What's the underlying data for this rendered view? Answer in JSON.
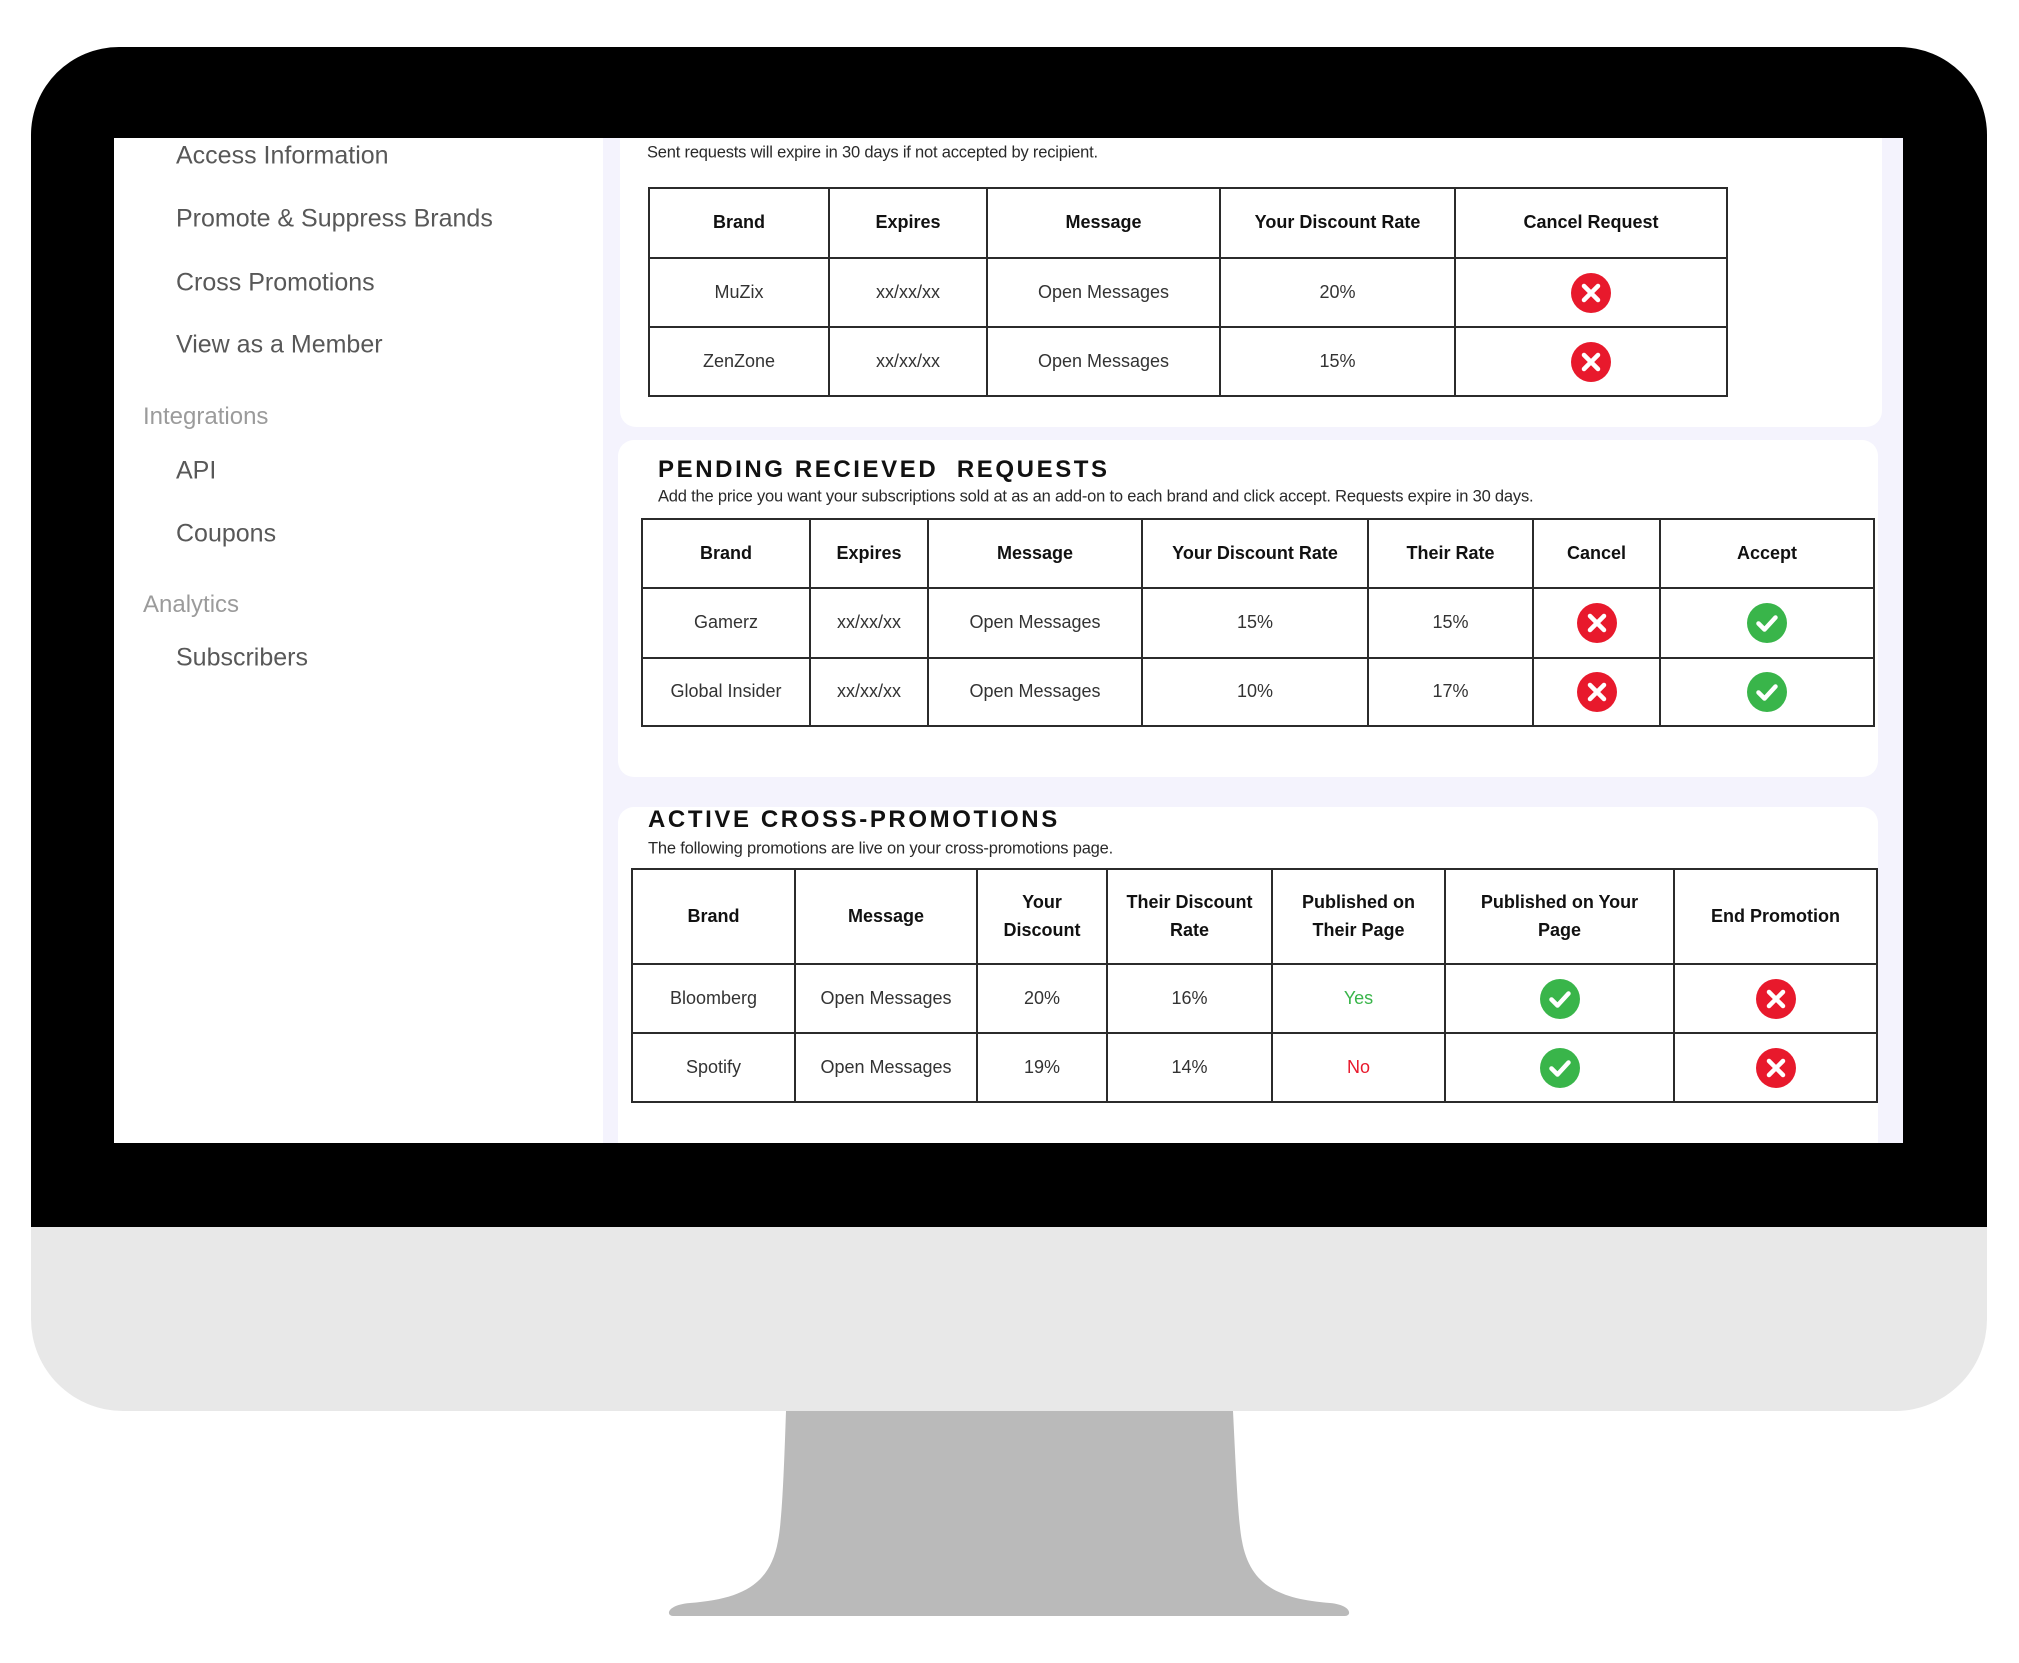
{
  "sidebar": {
    "items_top": [
      {
        "label": "Access Information"
      },
      {
        "label": "Promote & Suppress Brands"
      },
      {
        "label": "Cross Promotions"
      },
      {
        "label": "View as a Member"
      }
    ],
    "sections": [
      {
        "label": "Integrations",
        "items": [
          {
            "label": "API"
          },
          {
            "label": "Coupons"
          }
        ]
      },
      {
        "label": "Analytics",
        "items": [
          {
            "label": "Subscribers"
          }
        ]
      }
    ]
  },
  "sent_requests": {
    "subtitle": "Sent requests will expire in 30 days if not accepted by recipient.",
    "columns": [
      "Brand",
      "Expires",
      "Message",
      "Your Discount Rate",
      "Cancel Request"
    ],
    "rows": [
      {
        "brand": "MuZix",
        "expires": "xx/xx/xx",
        "message": "Open Messages",
        "your_discount_rate": "20%",
        "cancel_icon": "cancel-icon"
      },
      {
        "brand": "ZenZone",
        "expires": "xx/xx/xx",
        "message": "Open Messages",
        "your_discount_rate": "15%",
        "cancel_icon": "cancel-icon"
      }
    ]
  },
  "pending_received": {
    "title": "PENDING RECIEVED  REQUESTS",
    "subtitle": "Add the price you want your subscriptions sold at as an add-on to each brand and click accept. Requests expire in 30 days.",
    "columns": [
      "Brand",
      "Expires",
      "Message",
      "Your Discount Rate",
      "Their Rate",
      "Cancel",
      "Accept"
    ],
    "rows": [
      {
        "brand": "Gamerz",
        "expires": "xx/xx/xx",
        "message": "Open Messages",
        "your_discount_rate": "15%",
        "their_rate": "15%",
        "cancel_icon": "cancel-icon",
        "accept_icon": "accept-check-icon"
      },
      {
        "brand": "Global Insider",
        "expires": "xx/xx/xx",
        "message": "Open Messages",
        "your_discount_rate": "10%",
        "their_rate": "17%",
        "cancel_icon": "cancel-icon",
        "accept_icon": "accept-check-icon"
      }
    ]
  },
  "active_cross_promotions": {
    "title": "ACTIVE CROSS-PROMOTIONS",
    "subtitle": "The following promotions are live on your cross-promotions page.",
    "columns": [
      "Brand",
      "Message",
      "Your Discount",
      "Their Discount Rate",
      "Published on Their Page",
      "Published on Your Page",
      "End Promotion"
    ],
    "rows": [
      {
        "brand": "Bloomberg",
        "message": "Open Messages",
        "your_discount": "20%",
        "their_discount_rate": "16%",
        "published_on_their_page": "Yes",
        "published_on_your_page_icon": "check-icon",
        "end_icon": "end-promotion-icon"
      },
      {
        "brand": "Spotify",
        "message": "Open Messages",
        "your_discount": "19%",
        "their_discount_rate": "14%",
        "published_on_their_page": "No",
        "published_on_your_page_icon": "check-icon",
        "end_icon": "end-promotion-icon"
      }
    ]
  },
  "colors": {
    "cancel_red": "#e8192c",
    "accept_green": "#39b54a",
    "screen_background": "#f4f3fd",
    "bezel": "#000000",
    "chin": "#e8e8e8",
    "stand": "#bababa"
  }
}
